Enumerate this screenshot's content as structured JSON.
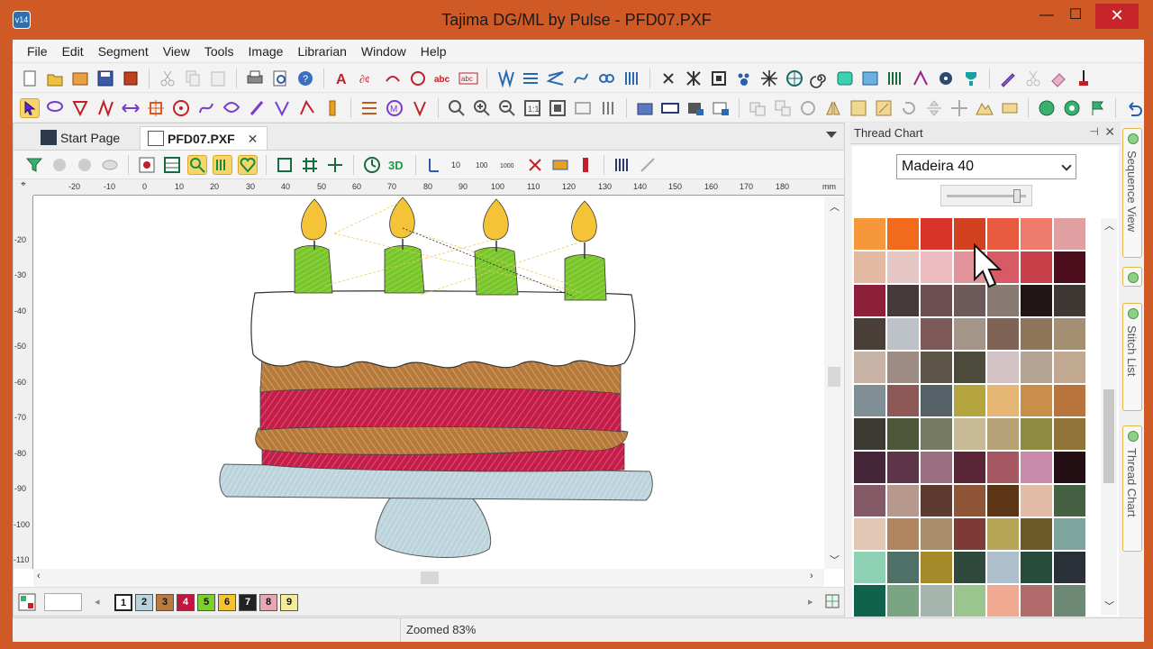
{
  "window": {
    "title": "Tajima DG/ML by Pulse - PFD07.PXF",
    "app_icon_text": "v14",
    "minimize": "—",
    "maximize": "☐",
    "close": "✕"
  },
  "menubar": {
    "items": [
      "File",
      "Edit",
      "Segment",
      "View",
      "Tools",
      "Image",
      "Librarian",
      "Window",
      "Help"
    ]
  },
  "tabs": [
    {
      "label": "Start Page",
      "active": false
    },
    {
      "label": "PFD07.PXF",
      "active": true,
      "close": "✕"
    }
  ],
  "rulers": {
    "top_labels": [
      "-20",
      "-10",
      "0",
      "10",
      "20",
      "30",
      "40",
      "50",
      "60",
      "70",
      "80",
      "90",
      "100",
      "110",
      "120",
      "130",
      "140",
      "150",
      "160",
      "170",
      "180"
    ],
    "unit": "mm",
    "left_labels": [
      "-20",
      "-30",
      "-40",
      "-50",
      "-60",
      "-70",
      "-80",
      "-90",
      "-100",
      "-110"
    ]
  },
  "colorbar": {
    "swatches": [
      {
        "label": "1",
        "color": "#ffffff",
        "text": "#111111"
      },
      {
        "label": "2",
        "color": "#b7d3dc",
        "text": "#111111"
      },
      {
        "label": "3",
        "color": "#b97a3e",
        "text": "#111111"
      },
      {
        "label": "4",
        "color": "#c1173e",
        "text": "#ffffff"
      },
      {
        "label": "5",
        "color": "#7ccf2c",
        "text": "#111111"
      },
      {
        "label": "6",
        "color": "#f4c430",
        "text": "#111111"
      },
      {
        "label": "7",
        "color": "#222222",
        "text": "#ffffff"
      },
      {
        "label": "8",
        "color": "#e8a7b5",
        "text": "#111111"
      },
      {
        "label": "9",
        "color": "#f5ec9a",
        "text": "#111111"
      }
    ]
  },
  "status": {
    "zoom_text": "Zoomed 83%"
  },
  "thread_chart": {
    "title": "Thread Chart",
    "pin": "📌",
    "close": "✕",
    "catalog": "Madeira 40",
    "colors": [
      [
        "#f5973a",
        "#f26a1b",
        "#d9342a",
        "#d1401f",
        "#e85a40",
        "#ee7b6c",
        "#e0a0a2"
      ],
      [
        "#e3b9a2",
        "#e6c6c2",
        "#eebcc0",
        "#e3939b",
        "#d75a64",
        "#c9404b",
        "#4c0e1c"
      ],
      [
        "#8e1f3a",
        "#46393b",
        "#6d4f52",
        "#6b5a58",
        "#877a73",
        "#201616",
        "#3e3733"
      ],
      [
        "#4a3e39",
        "#bcc2c8",
        "#7d5a57",
        "#a39588",
        "#7f6456",
        "#8e7458",
        "#a48f72"
      ],
      [
        "#c8b4a6",
        "#9d8c84",
        "#5f5448",
        "#4c4a3b",
        "#d2c2c3",
        "#b4a392",
        "#c0a891"
      ],
      [
        "#808f95",
        "#8e5856",
        "#566067",
        "#b4a43e",
        "#e6b675",
        "#c98e4a",
        "#b8743a"
      ],
      [
        "#3d3a34",
        "#4d5737",
        "#777a63",
        "#c7ba94",
        "#b6a276",
        "#8e8a3f",
        "#8f7338"
      ],
      [
        "#442638",
        "#5e3448",
        "#9c6f80",
        "#5a2536",
        "#a55861",
        "#c98aac",
        "#230e13"
      ],
      [
        "#845a67",
        "#b6988c",
        "#5d3a2f",
        "#8e5536",
        "#5c3416",
        "#e2bca7",
        "#466043"
      ],
      [
        "#e2c8b4",
        "#b1865e",
        "#a98c69",
        "#7e3b36",
        "#b7a556",
        "#6d5a28",
        "#7da59e"
      ],
      [
        "#8ed1b5",
        "#4e7066",
        "#a58a2a",
        "#2f4a3c",
        "#aebecb",
        "#274c3c",
        "#2a3038"
      ],
      [
        "#11624a",
        "#7aa482",
        "#a5b4ad",
        "#9ac58e",
        "#f0aa92",
        "#b06b6a",
        "#6e8876"
      ]
    ]
  },
  "sidetabs": [
    {
      "label": "Sequence View"
    },
    {
      "label": "Stitch List"
    },
    {
      "label": "Thread Chart"
    }
  ]
}
